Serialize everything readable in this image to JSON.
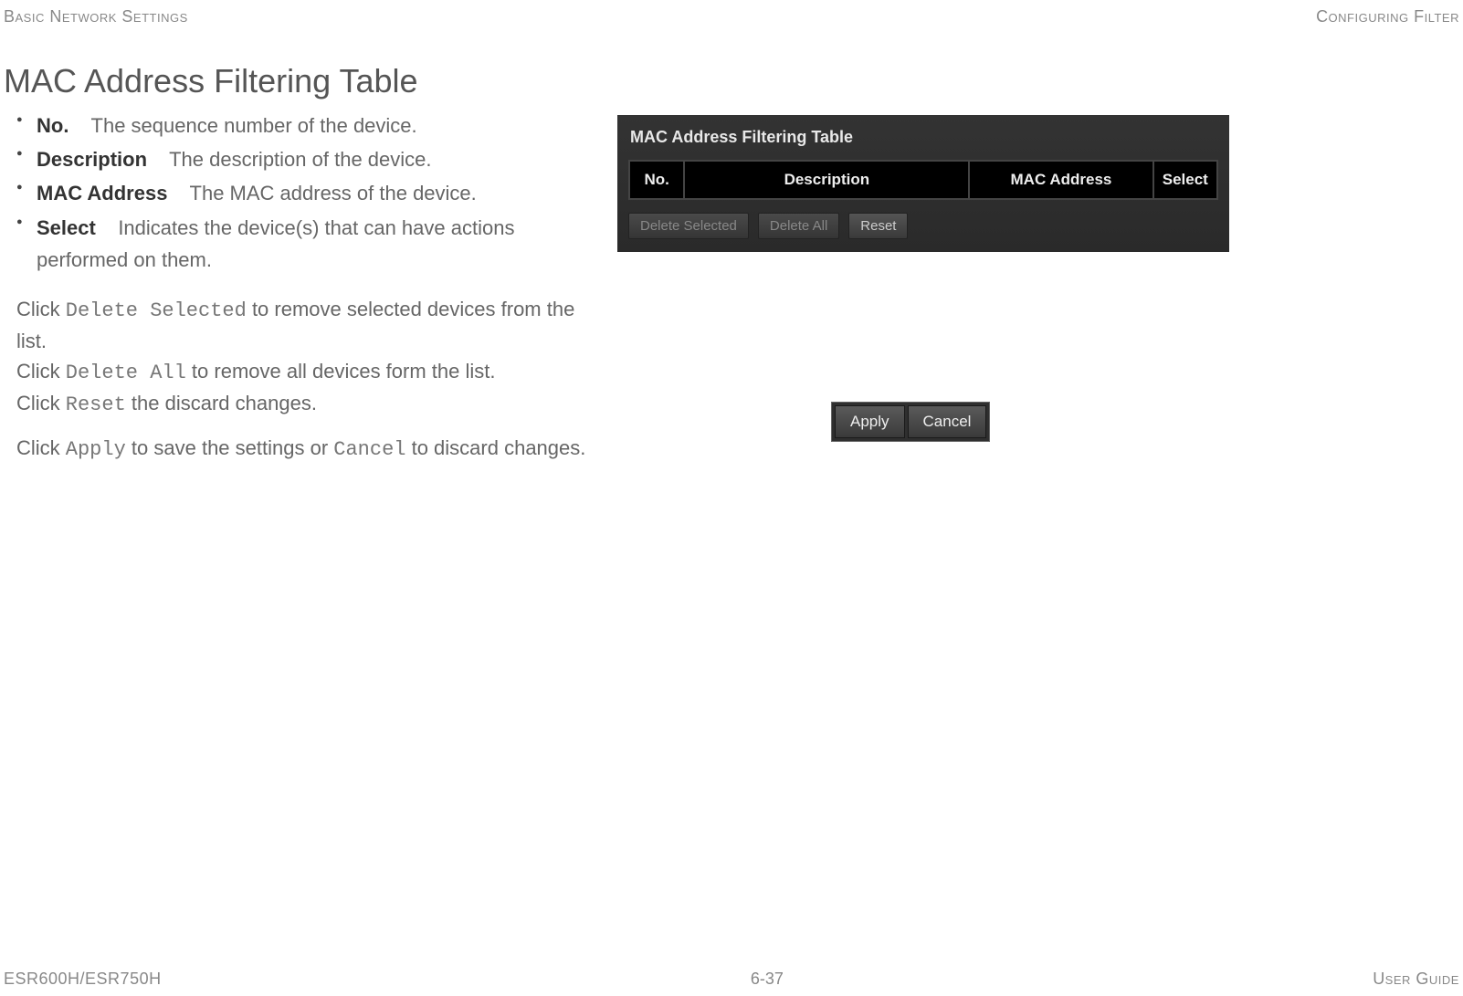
{
  "header": {
    "left": "Basic Network Settings",
    "right": "Configuring Filter"
  },
  "title": "MAC Address Filtering Table",
  "fields": [
    {
      "term": "No.",
      "desc": "The sequence number of the device."
    },
    {
      "term": "Description",
      "desc": "The description of the device."
    },
    {
      "term": "MAC Address",
      "desc": "The MAC address of the device."
    },
    {
      "term": "Select",
      "desc": "Indicates the device(s) that can have actions performed on them."
    }
  ],
  "instructions": {
    "line1a": "Click ",
    "line1cmd": "Delete Selected",
    "line1b": " to remove selected devices from the list.",
    "line2a": "Click ",
    "line2cmd": "Delete All",
    "line2b": " to remove all devices form the list.",
    "line3a": "Click ",
    "line3cmd": "Reset",
    "line3b": " the discard changes.",
    "line4a": "Click ",
    "line4cmd1": "Apply",
    "line4b": " to save the settings or ",
    "line4cmd2": "Cancel",
    "line4c": " to discard changes."
  },
  "panel": {
    "title": "MAC Address Filtering Table",
    "columns": {
      "no": "No.",
      "desc": "Description",
      "mac": "MAC Address",
      "sel": "Select"
    },
    "buttons": {
      "del_sel": "Delete Selected",
      "del_all": "Delete All",
      "reset": "Reset"
    }
  },
  "apply_cancel": {
    "apply": "Apply",
    "cancel": "Cancel"
  },
  "footer": {
    "left": "ESR600H/ESR750H",
    "center": "6-37",
    "right": "User Guide"
  }
}
